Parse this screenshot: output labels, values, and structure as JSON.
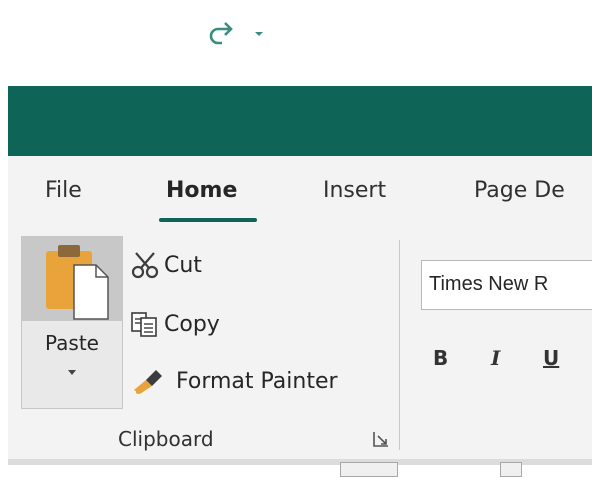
{
  "quick_access": {
    "icons": [
      "save-icon",
      "undo-icon",
      "redo-icon",
      "customize-icon"
    ],
    "bar_color": "#0f6458"
  },
  "tabs": [
    {
      "label": "File",
      "active": false
    },
    {
      "label": "Home",
      "active": true
    },
    {
      "label": "Insert",
      "active": false
    },
    {
      "label": "Page De",
      "active": false
    }
  ],
  "clipboard": {
    "paste_label": "Paste",
    "cut_label": "Cut",
    "copy_label": "Copy",
    "format_painter_label": "Format Painter",
    "group_label": "Clipboard"
  },
  "font": {
    "name_value": "Times New R",
    "bold_label": "B",
    "italic_label": "I",
    "underline_label": "U"
  },
  "colors": {
    "accent": "#0f6458",
    "ribbon_bg": "#f3f3f3"
  }
}
